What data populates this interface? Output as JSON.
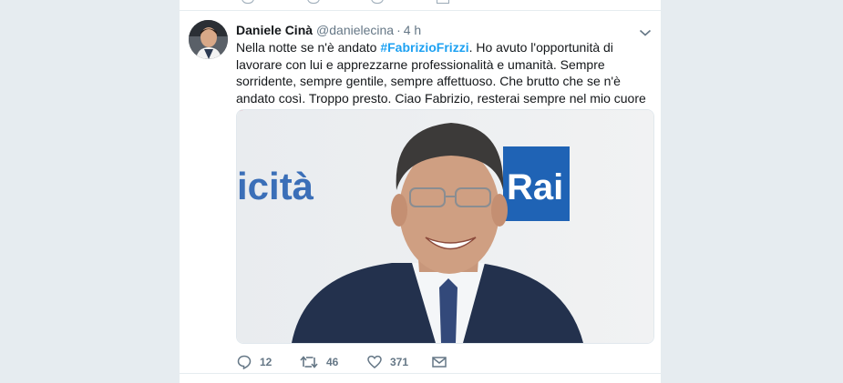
{
  "tweet": {
    "author_name": "Daniele Cinà",
    "author_handle": "@danielecina",
    "separator": "·",
    "time": "4 h",
    "text_before": "Nella notte se n'è andato ",
    "hashtag": "#FabrizioFrizzi",
    "text_after": ". Ho avuto l'opportunità di lavorare con lui e apprezzarne professionalità e umanità. Sempre sorridente, sempre gentile, sempre affettuoso. Che brutto che se n'è andato così. Troppo presto. Ciao Fabrizio, resterai sempre nel mio cuore",
    "media": {
      "backdrop_text_left": "icità",
      "backdrop_text_right": "Rai"
    },
    "actions": {
      "reply_count": "12",
      "retweet_count": "46",
      "like_count": "371"
    }
  },
  "icons": {
    "caret": "chevron-down-icon",
    "heart_emoji": "heart-icon",
    "reply": "reply-icon",
    "retweet": "retweet-icon",
    "like": "like-icon",
    "direct_message": "envelope-icon"
  },
  "colors": {
    "link": "#1da1f2",
    "muted": "#657786",
    "background": "#e6ecf0",
    "rai_blue": "#1f63b5",
    "heart": "#d3173b"
  }
}
